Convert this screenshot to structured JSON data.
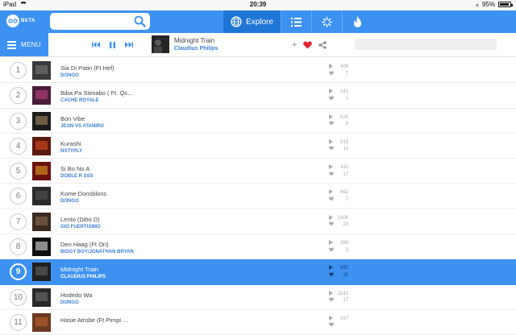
{
  "status": {
    "device": "iPad",
    "time": "20:39",
    "battery": "95%",
    "battery_level": 0.95
  },
  "topbar": {
    "logo_text": "BETA",
    "logo_mark": "SOUND",
    "search_placeholder": "",
    "explore_label": "Explore",
    "tab_icons": [
      "globe-icon",
      "list-icon",
      "loading-icon",
      "flame-icon"
    ]
  },
  "player": {
    "menu_label": "MENU",
    "now_title": "Midnight Train",
    "now_artist": "Claudius Philips",
    "heart_color": "#e0222c"
  },
  "tracks": [
    {
      "rank": "1",
      "title": "Sia Di Patin (Ft Hef)",
      "artist": "DONGO",
      "plays": "406",
      "likes": "7",
      "thumb": "#3a3a3a",
      "thumb2": "#777777"
    },
    {
      "rank": "2",
      "title": "Biba Pa Stimabo ( Ft. Qs…",
      "artist": "CACHE ROYALE",
      "plays": "241",
      "likes": "1",
      "thumb": "#4a1e3a",
      "thumb2": "#c04080"
    },
    {
      "rank": "3",
      "title": "Bon Vibe",
      "artist": "JEON VS ATANIRO",
      "plays": "526",
      "likes": "8",
      "thumb": "#1c1c1c",
      "thumb2": "#a08a60"
    },
    {
      "rank": "4",
      "title": "Kurashi",
      "artist": "NSTYPLY",
      "plays": "519",
      "likes": "11",
      "thumb": "#5a1a10",
      "thumb2": "#d84c20"
    },
    {
      "rank": "5",
      "title": "Si Bo No A",
      "artist": "DOBLE R SSS",
      "plays": "431",
      "likes": "17",
      "thumb": "#6a1010",
      "thumb2": "#e0a020"
    },
    {
      "rank": "6",
      "title": "Kome Donsblons",
      "artist": "DONGO",
      "plays": "662",
      "likes": "7",
      "thumb": "#2a2a2a",
      "thumb2": "#555555"
    },
    {
      "rank": "7",
      "title": "Lento (Dibo D)",
      "artist": "GIO FUERTISIMO",
      "plays": "1406",
      "likes": "23",
      "thumb": "#3a2a20",
      "thumb2": "#8a6a50"
    },
    {
      "rank": "8",
      "title": "Den Haag (Ft Ori)",
      "artist": "BIGGY BOY/JONATHAN BRYAN",
      "plays": "368",
      "likes": "3",
      "thumb": "#101010",
      "thumb2": "#dddddd"
    },
    {
      "rank": "9",
      "title": "Midnight Train",
      "artist": "CLAUDIUS PHILIPS",
      "plays": "932",
      "likes": "15",
      "thumb": "#202020",
      "thumb2": "#666666",
      "active": true
    },
    {
      "rank": "10",
      "title": "Hodedo Wa",
      "artist": "DONGO",
      "plays": "3142",
      "likes": "17",
      "thumb": "#2a2a2a",
      "thumb2": "#707070"
    },
    {
      "rank": "11",
      "title": "Hasie Atrobe (Ft Pimpi …",
      "artist": "",
      "plays": "167",
      "likes": "",
      "thumb": "#6a3a20",
      "thumb2": "#c06030"
    }
  ]
}
